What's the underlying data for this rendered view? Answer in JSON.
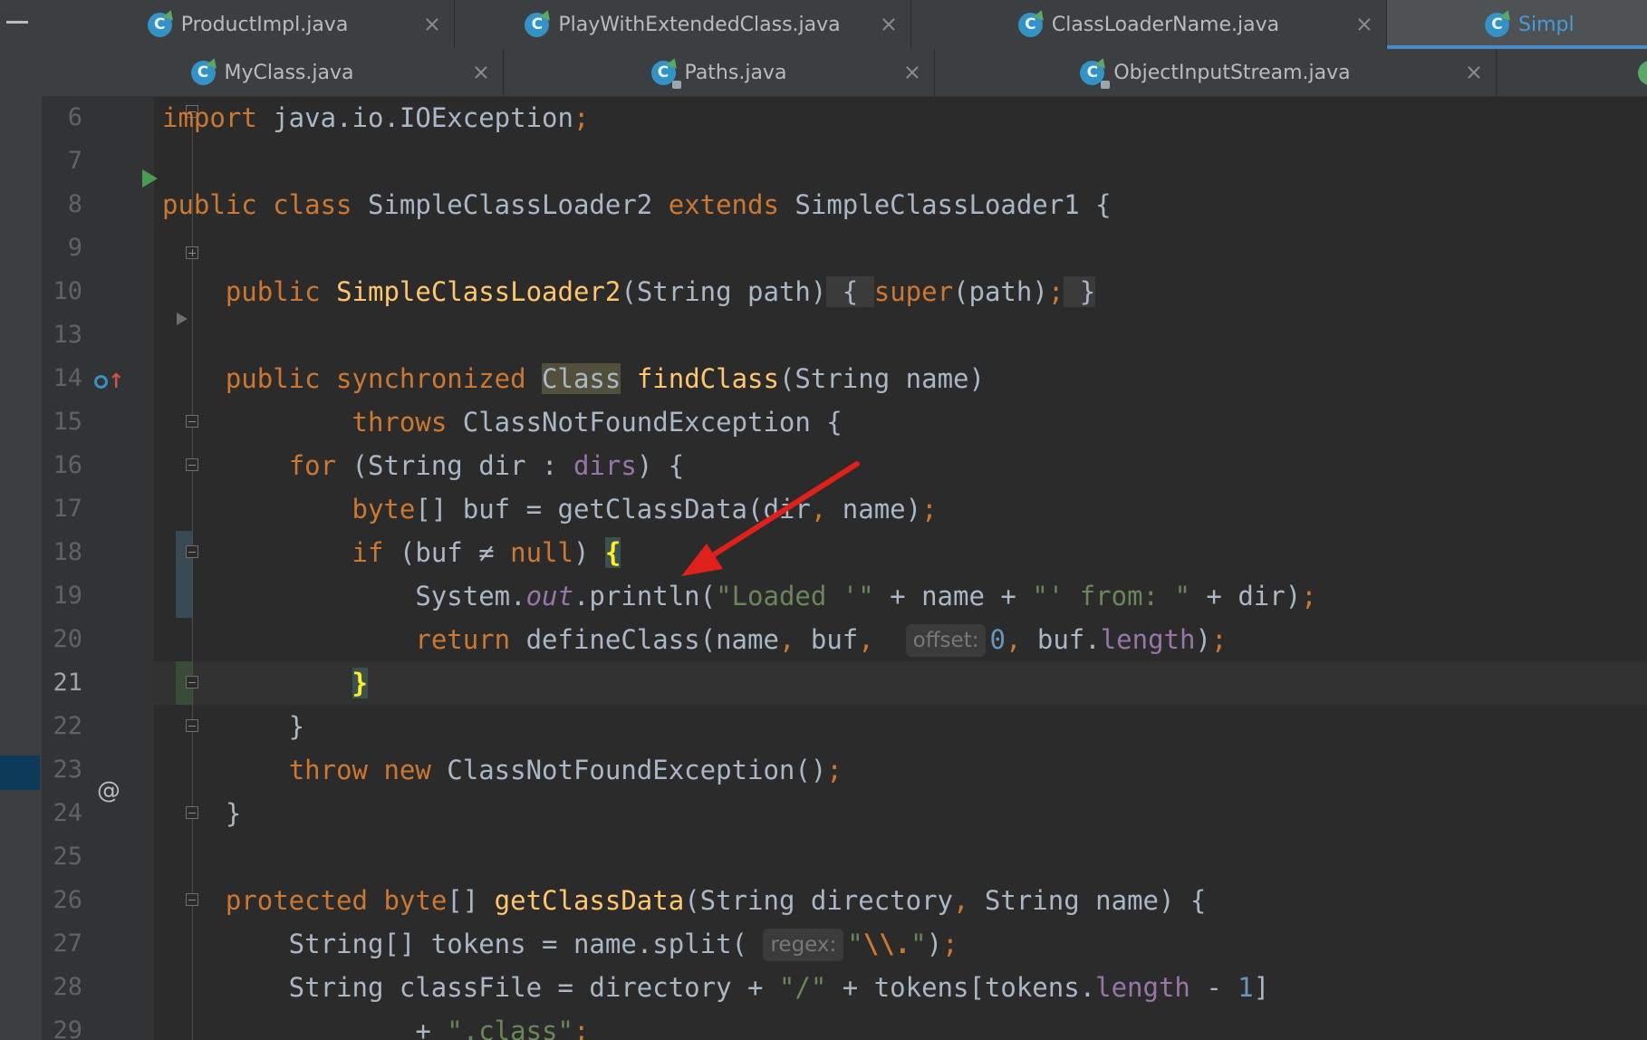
{
  "tabs_row1": [
    {
      "label": "ProductImpl.java",
      "icon": "java-class-icon",
      "active": false
    },
    {
      "label": "PlayWithExtendedClass.java",
      "icon": "java-class-icon",
      "active": false
    },
    {
      "label": "ClassLoaderName.java",
      "icon": "java-class-icon",
      "active": false
    },
    {
      "label": "Simpl",
      "icon": "java-class-icon",
      "active": true
    }
  ],
  "tabs_row2": [
    {
      "label": "MyClass.java",
      "icon": "java-class-icon"
    },
    {
      "label": "Paths.java",
      "icon": "java-class-locked-icon"
    },
    {
      "label": "ObjectInputStream.java",
      "icon": "java-class-locked-icon"
    }
  ],
  "close_glyph": "×",
  "editor": {
    "current_line": "21",
    "lines": [
      {
        "num": "6"
      },
      {
        "num": "7"
      },
      {
        "num": "8"
      },
      {
        "num": "9"
      },
      {
        "num": "10"
      },
      {
        "num": "13"
      },
      {
        "num": "14"
      },
      {
        "num": "15"
      },
      {
        "num": "16"
      },
      {
        "num": "17"
      },
      {
        "num": "18"
      },
      {
        "num": "19"
      },
      {
        "num": "20"
      },
      {
        "num": "21"
      },
      {
        "num": "22"
      },
      {
        "num": "23"
      },
      {
        "num": "24"
      },
      {
        "num": "25"
      },
      {
        "num": "26"
      },
      {
        "num": "27"
      },
      {
        "num": "28"
      },
      {
        "num": "29"
      }
    ],
    "hints": {
      "offset": "offset:",
      "regex": "regex:"
    }
  },
  "annotation": {
    "color": "#e0201b"
  }
}
